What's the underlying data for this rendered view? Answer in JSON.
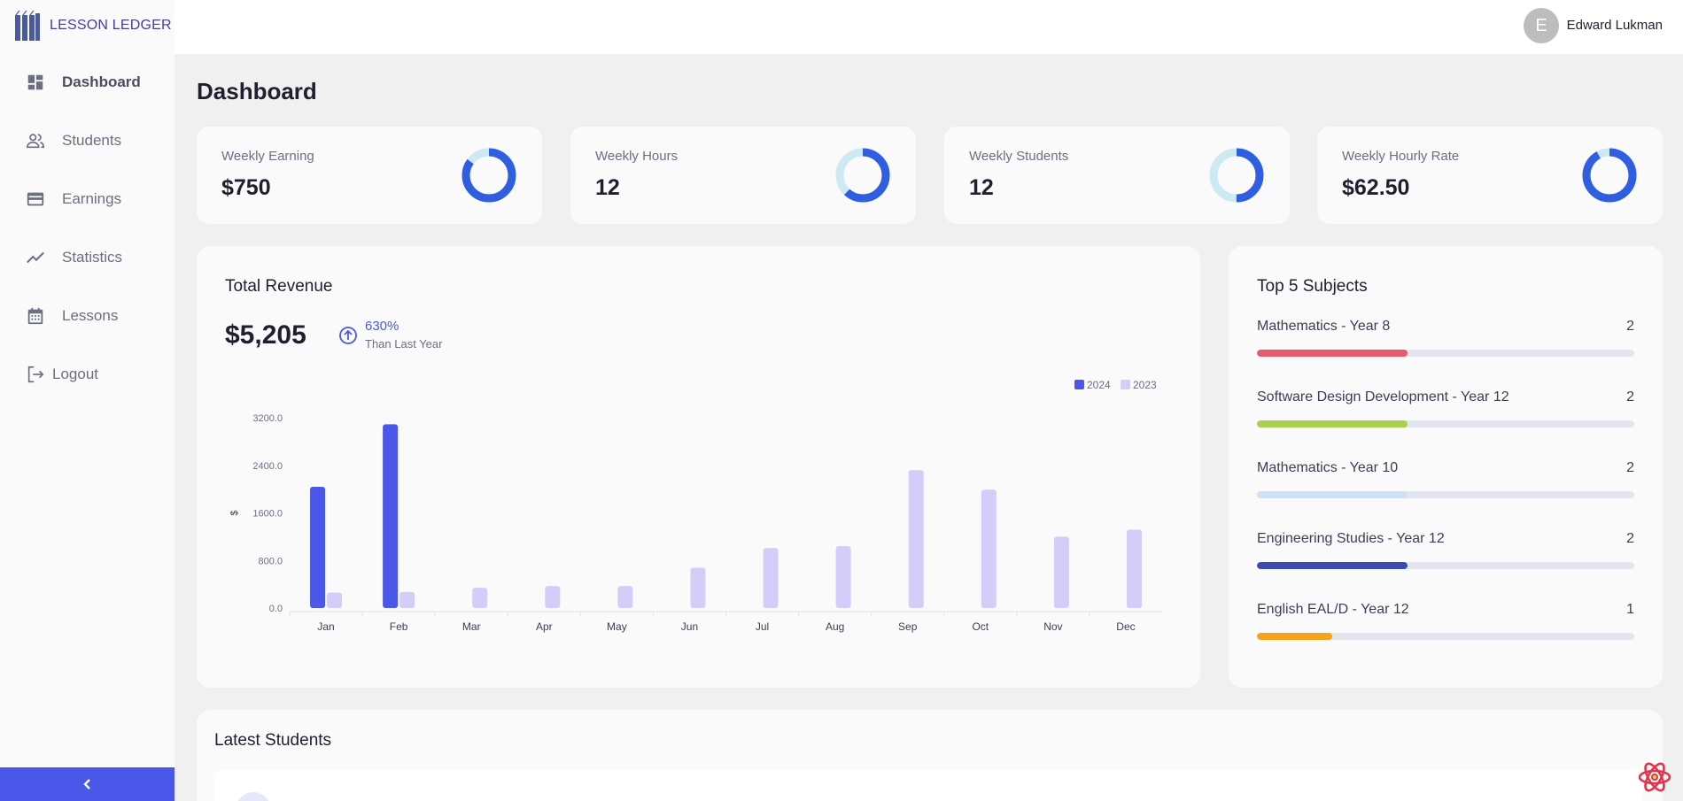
{
  "app": {
    "logo_text": "LESSON LEDGER"
  },
  "sidebar": {
    "items": [
      {
        "label": "Dashboard",
        "icon": "dashboard-icon",
        "active": true
      },
      {
        "label": "Students",
        "icon": "people-icon",
        "active": false
      },
      {
        "label": "Earnings",
        "icon": "wallet-icon",
        "active": false
      },
      {
        "label": "Statistics",
        "icon": "trend-icon",
        "active": false
      },
      {
        "label": "Lessons",
        "icon": "calendar-icon",
        "active": false
      }
    ],
    "logout_label": "Logout",
    "collapse_icon": "chevron-left-icon"
  },
  "header": {
    "avatar_initial": "E",
    "user_name": "Edward Lukman"
  },
  "page": {
    "title": "Dashboard"
  },
  "stats": [
    {
      "label": "Weekly Earning",
      "value": "$750",
      "ring_fraction": 0.85
    },
    {
      "label": "Weekly Hours",
      "value": "12",
      "ring_fraction": 0.62
    },
    {
      "label": "Weekly Students",
      "value": "12",
      "ring_fraction": 0.5
    },
    {
      "label": "Weekly Hourly Rate",
      "value": "$62.50",
      "ring_fraction": 0.92
    }
  ],
  "revenue": {
    "title": "Total Revenue",
    "total": "$5,205",
    "change_pct": "630%",
    "change_text": "Than Last Year"
  },
  "chart_data": {
    "type": "bar",
    "categories": [
      "Jan",
      "Feb",
      "Mar",
      "Apr",
      "May",
      "Jun",
      "Jul",
      "Aug",
      "Sep",
      "Oct",
      "Nov",
      "Dec"
    ],
    "series": [
      {
        "name": "2024",
        "color": "#4a57e8",
        "values": [
          2040,
          3090,
          0,
          0,
          0,
          0,
          0,
          0,
          0,
          0,
          0,
          0
        ]
      },
      {
        "name": "2023",
        "color": "#d4cdfa",
        "values": [
          260,
          270,
          340,
          370,
          370,
          680,
          1010,
          1040,
          2320,
          1990,
          1200,
          1320
        ]
      }
    ],
    "ylabel": "$",
    "ylim": [
      0,
      3200
    ],
    "yticks": [
      "0.0",
      "800.0",
      "1600.0",
      "2400.0",
      "3200.0"
    ],
    "legend": "top-right"
  },
  "subjects": {
    "title": "Top 5 Subjects",
    "items": [
      {
        "name": "Mathematics - Year 8",
        "count": "2",
        "fill": 0.4,
        "color": "#ea5a6e"
      },
      {
        "name": "Software Design Development - Year 12",
        "count": "2",
        "fill": 0.4,
        "color": "#a8d04c"
      },
      {
        "name": "Mathematics - Year 10",
        "count": "2",
        "fill": 0.4,
        "color": "#cfe1f7"
      },
      {
        "name": "Engineering Studies - Year 12",
        "count": "2",
        "fill": 0.4,
        "color": "#3b4bb0"
      },
      {
        "name": "English EAL/D - Year 12",
        "count": "1",
        "fill": 0.2,
        "color": "#f5a417"
      }
    ]
  },
  "latest": {
    "title": "Latest Students"
  }
}
